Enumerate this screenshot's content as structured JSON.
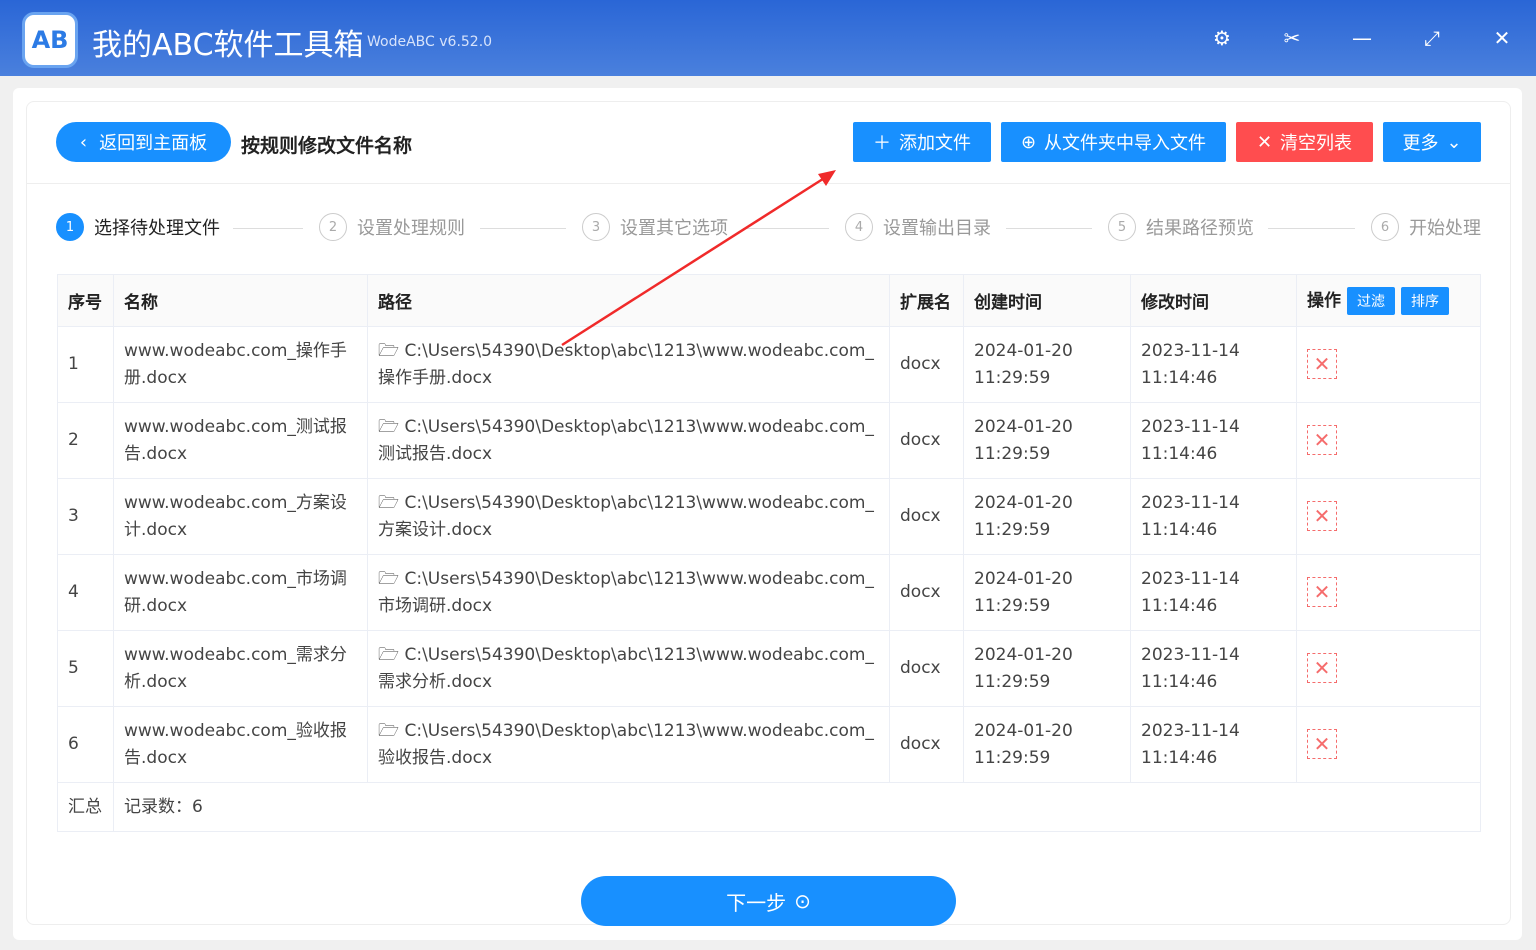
{
  "app": {
    "title": "我的ABC软件工具箱",
    "version": "WodeABC v6.52.0",
    "logo": "AB"
  },
  "window_icons": [
    "gear-icon",
    "scissors-icon",
    "minimize-icon",
    "maximize-icon",
    "close-icon"
  ],
  "header": {
    "back": "返回到主面板",
    "title": "按规则修改文件名称",
    "add_file": "添加文件",
    "import_folder": "从文件夹中导入文件",
    "clear_list": "清空列表",
    "more": "更多"
  },
  "steps": [
    {
      "n": "1",
      "label": "选择待处理文件"
    },
    {
      "n": "2",
      "label": "设置处理规则"
    },
    {
      "n": "3",
      "label": "设置其它选项"
    },
    {
      "n": "4",
      "label": "设置输出目录"
    },
    {
      "n": "5",
      "label": "结果路径预览"
    },
    {
      "n": "6",
      "label": "开始处理"
    }
  ],
  "table": {
    "headers": [
      "序号",
      "名称",
      "路径",
      "扩展名",
      "创建时间",
      "修改时间",
      "操作"
    ],
    "filter": "过滤",
    "sort": "排序",
    "rows": [
      {
        "idx": "1",
        "name": "www.wodeabc.com_操作手册.docx",
        "path": "C:\\Users\\54390\\Desktop\\abc\\1213\\www.wodeabc.com_操作手册.docx",
        "ext": "docx",
        "created": "2024-01-20 11:29:59",
        "modified": "2023-11-14 11:14:46"
      },
      {
        "idx": "2",
        "name": "www.wodeabc.com_测试报告.docx",
        "path": "C:\\Users\\54390\\Desktop\\abc\\1213\\www.wodeabc.com_测试报告.docx",
        "ext": "docx",
        "created": "2024-01-20 11:29:59",
        "modified": "2023-11-14 11:14:46"
      },
      {
        "idx": "3",
        "name": "www.wodeabc.com_方案设计.docx",
        "path": "C:\\Users\\54390\\Desktop\\abc\\1213\\www.wodeabc.com_方案设计.docx",
        "ext": "docx",
        "created": "2024-01-20 11:29:59",
        "modified": "2023-11-14 11:14:46"
      },
      {
        "idx": "4",
        "name": "www.wodeabc.com_市场调研.docx",
        "path": "C:\\Users\\54390\\Desktop\\abc\\1213\\www.wodeabc.com_市场调研.docx",
        "ext": "docx",
        "created": "2024-01-20 11:29:59",
        "modified": "2023-11-14 11:14:46"
      },
      {
        "idx": "5",
        "name": "www.wodeabc.com_需求分析.docx",
        "path": "C:\\Users\\54390\\Desktop\\abc\\1213\\www.wodeabc.com_需求分析.docx",
        "ext": "docx",
        "created": "2024-01-20 11:29:59",
        "modified": "2023-11-14 11:14:46"
      },
      {
        "idx": "6",
        "name": "www.wodeabc.com_验收报告.docx",
        "path": "C:\\Users\\54390\\Desktop\\abc\\1213\\www.wodeabc.com_验收报告.docx",
        "ext": "docx",
        "created": "2024-01-20 11:29:59",
        "modified": "2023-11-14 11:14:46"
      }
    ],
    "summary_label": "汇总",
    "summary_count": "记录数：6"
  },
  "next": "下一步"
}
